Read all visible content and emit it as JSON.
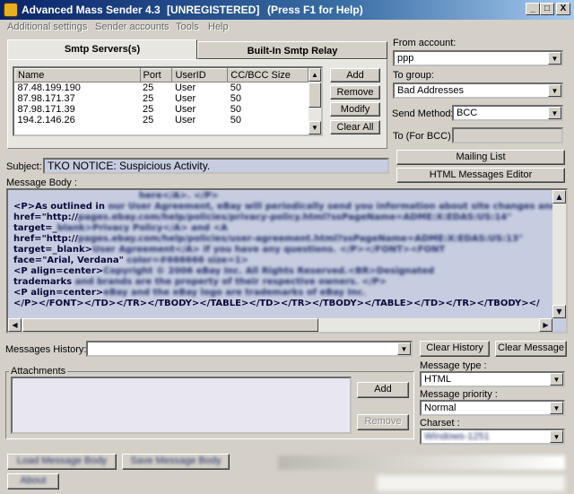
{
  "window": {
    "title": "Advanced Mass Sender 4.3",
    "registration": "[UNREGISTERED]",
    "help_hint": "(Press F1 for Help)",
    "min_label": "_",
    "max_label": "□",
    "close_label": "X"
  },
  "menu": [
    "Additional settings",
    "Sender accounts",
    "Tools",
    "Help"
  ],
  "tabs": {
    "smtp": "Smtp Servers(s)",
    "relay": "Built-In Smtp Relay"
  },
  "servers": {
    "columns": [
      "Name",
      "Port",
      "UserID",
      "CC/BCC Size"
    ],
    "rows": [
      [
        "87.48.199.190",
        "25",
        "User",
        "50"
      ],
      [
        "87.98.171.37",
        "25",
        "User",
        "50"
      ],
      [
        "87.98.171.39",
        "25",
        "User",
        "50"
      ],
      [
        "194.2.146.26",
        "25",
        "User",
        "50"
      ]
    ],
    "buttons": {
      "add": "Add",
      "remove": "Remove",
      "modify": "Modify",
      "clear_all": "Clear All"
    }
  },
  "account": {
    "from_label": "From account:",
    "from_value": "ppp",
    "group_label": "To group:",
    "group_value": "Bad Addresses",
    "method_label": "Send Method:",
    "method_value": "BCC",
    "bcc_label": "To (For BCC)",
    "bcc_value": ""
  },
  "subject": {
    "label": "Subject:",
    "value": "TKO NOTICE: Suspicious Activity."
  },
  "side_buttons": {
    "mailing_list": "Mailing List",
    "html_editor": "HTML Messages Editor"
  },
  "message_body": {
    "label": "Message Body :",
    "lines": [
      {
        "clear": "",
        "blurred": "here</A>. </P>"
      },
      {
        "clear": "<P>As outlined in ",
        "blurred": "our User Agreement, eBay will periodically send you information about site changes and enh"
      },
      {
        "clear": "href=\"http://",
        "blurred": "pages.ebay.com/help/policies/privacy-policy.html?ssPageName=ADME:X:EDAS:US:14\""
      },
      {
        "clear": "target=_",
        "blurred": "blank>Privacy Policy</A> and <A"
      },
      {
        "clear": "href=\"http://",
        "blurred": "pages.ebay.com/help/policies/user-agreement.html?ssPageName=ADME:X:EDAS:US:13\""
      },
      {
        "clear": "target=_blank>",
        "blurred": "User Agreement</A> if you have any questions. </P></FONT><FONT"
      },
      {
        "clear": "face=\"Arial, Verdana\" ",
        "blurred": "color=#666666 size=1>"
      },
      {
        "clear": "<P align=center>",
        "blurred": "Copyright © 2006 eBay Inc. All Rights Reserved.<BR>Designated"
      },
      {
        "clear": "trademarks ",
        "blurred": "and brands are the property of their respective owners. </P>"
      },
      {
        "clear": "<P align=center>",
        "blurred": "eBay and the eBay logo are trademarks of eBay Inc."
      },
      {
        "clear": "</P></FONT></TD></TR></TBODY></TABLE></TD></TR></TBODY></TABLE></TD></TR></TBODY></",
        "blurred": ""
      }
    ]
  },
  "history": {
    "label": "Messages History:",
    "value": "",
    "clear_history": "Clear History",
    "clear_message": "Clear Message"
  },
  "attachments": {
    "label": "Attachments",
    "add": "Add",
    "remove": "Remove"
  },
  "message_options": {
    "type_label": "Message type :",
    "type_value": "HTML",
    "priority_label": "Message priority :",
    "priority_value": "Normal",
    "charset_label": "Charset :",
    "charset_value": "Windows-1251"
  },
  "bottom_buttons": {
    "load": "Load Message Body",
    "save": "Save Message Body",
    "about": "About"
  }
}
